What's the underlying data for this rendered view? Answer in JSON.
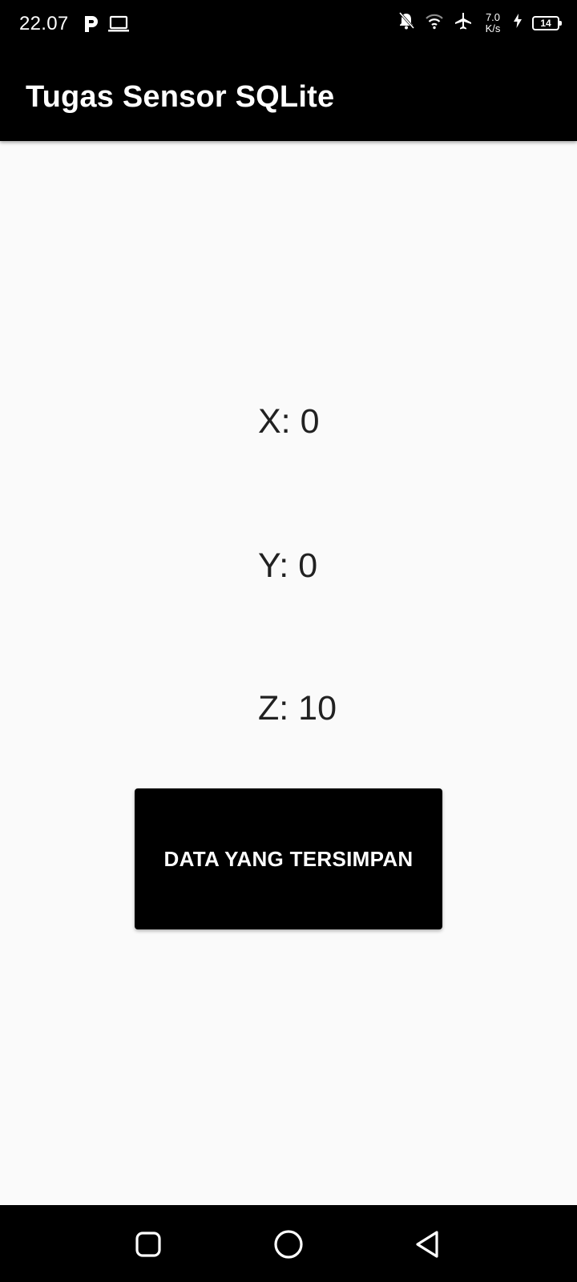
{
  "status_bar": {
    "time": "22.07",
    "net_speed_value": "7.0",
    "net_speed_unit": "K/s",
    "battery_level": "14",
    "icons": [
      "parking-icon",
      "laptop-icon",
      "notifications-off-icon",
      "wifi-icon",
      "airplane-mode-icon",
      "charging-icon",
      "battery-icon"
    ]
  },
  "app_bar": {
    "title": "Tugas Sensor SQLite"
  },
  "sensor": {
    "x_text": "X: 0",
    "y_text": "Y: 0",
    "z_text": "Z: 10"
  },
  "actions": {
    "saved_data_label": "DATA YANG TERSIMPAN"
  },
  "nav_bar": {
    "icons": [
      "recents-icon",
      "home-icon",
      "back-icon"
    ]
  },
  "colors": {
    "bar_background": "#000000",
    "page_background": "#fafafa",
    "text_primary": "#212121",
    "button_background": "#000000",
    "button_text": "#ffffff"
  }
}
